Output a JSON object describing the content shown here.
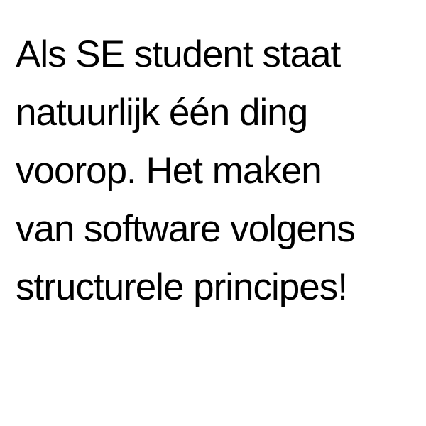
{
  "text": {
    "lines": [
      "Als SE student staat",
      "natuurlijk één ding",
      "voorop. Het maken",
      "van software volgens",
      "structurele principes!"
    ]
  },
  "colors": {
    "background": "#ffffff",
    "text": "#000000"
  }
}
